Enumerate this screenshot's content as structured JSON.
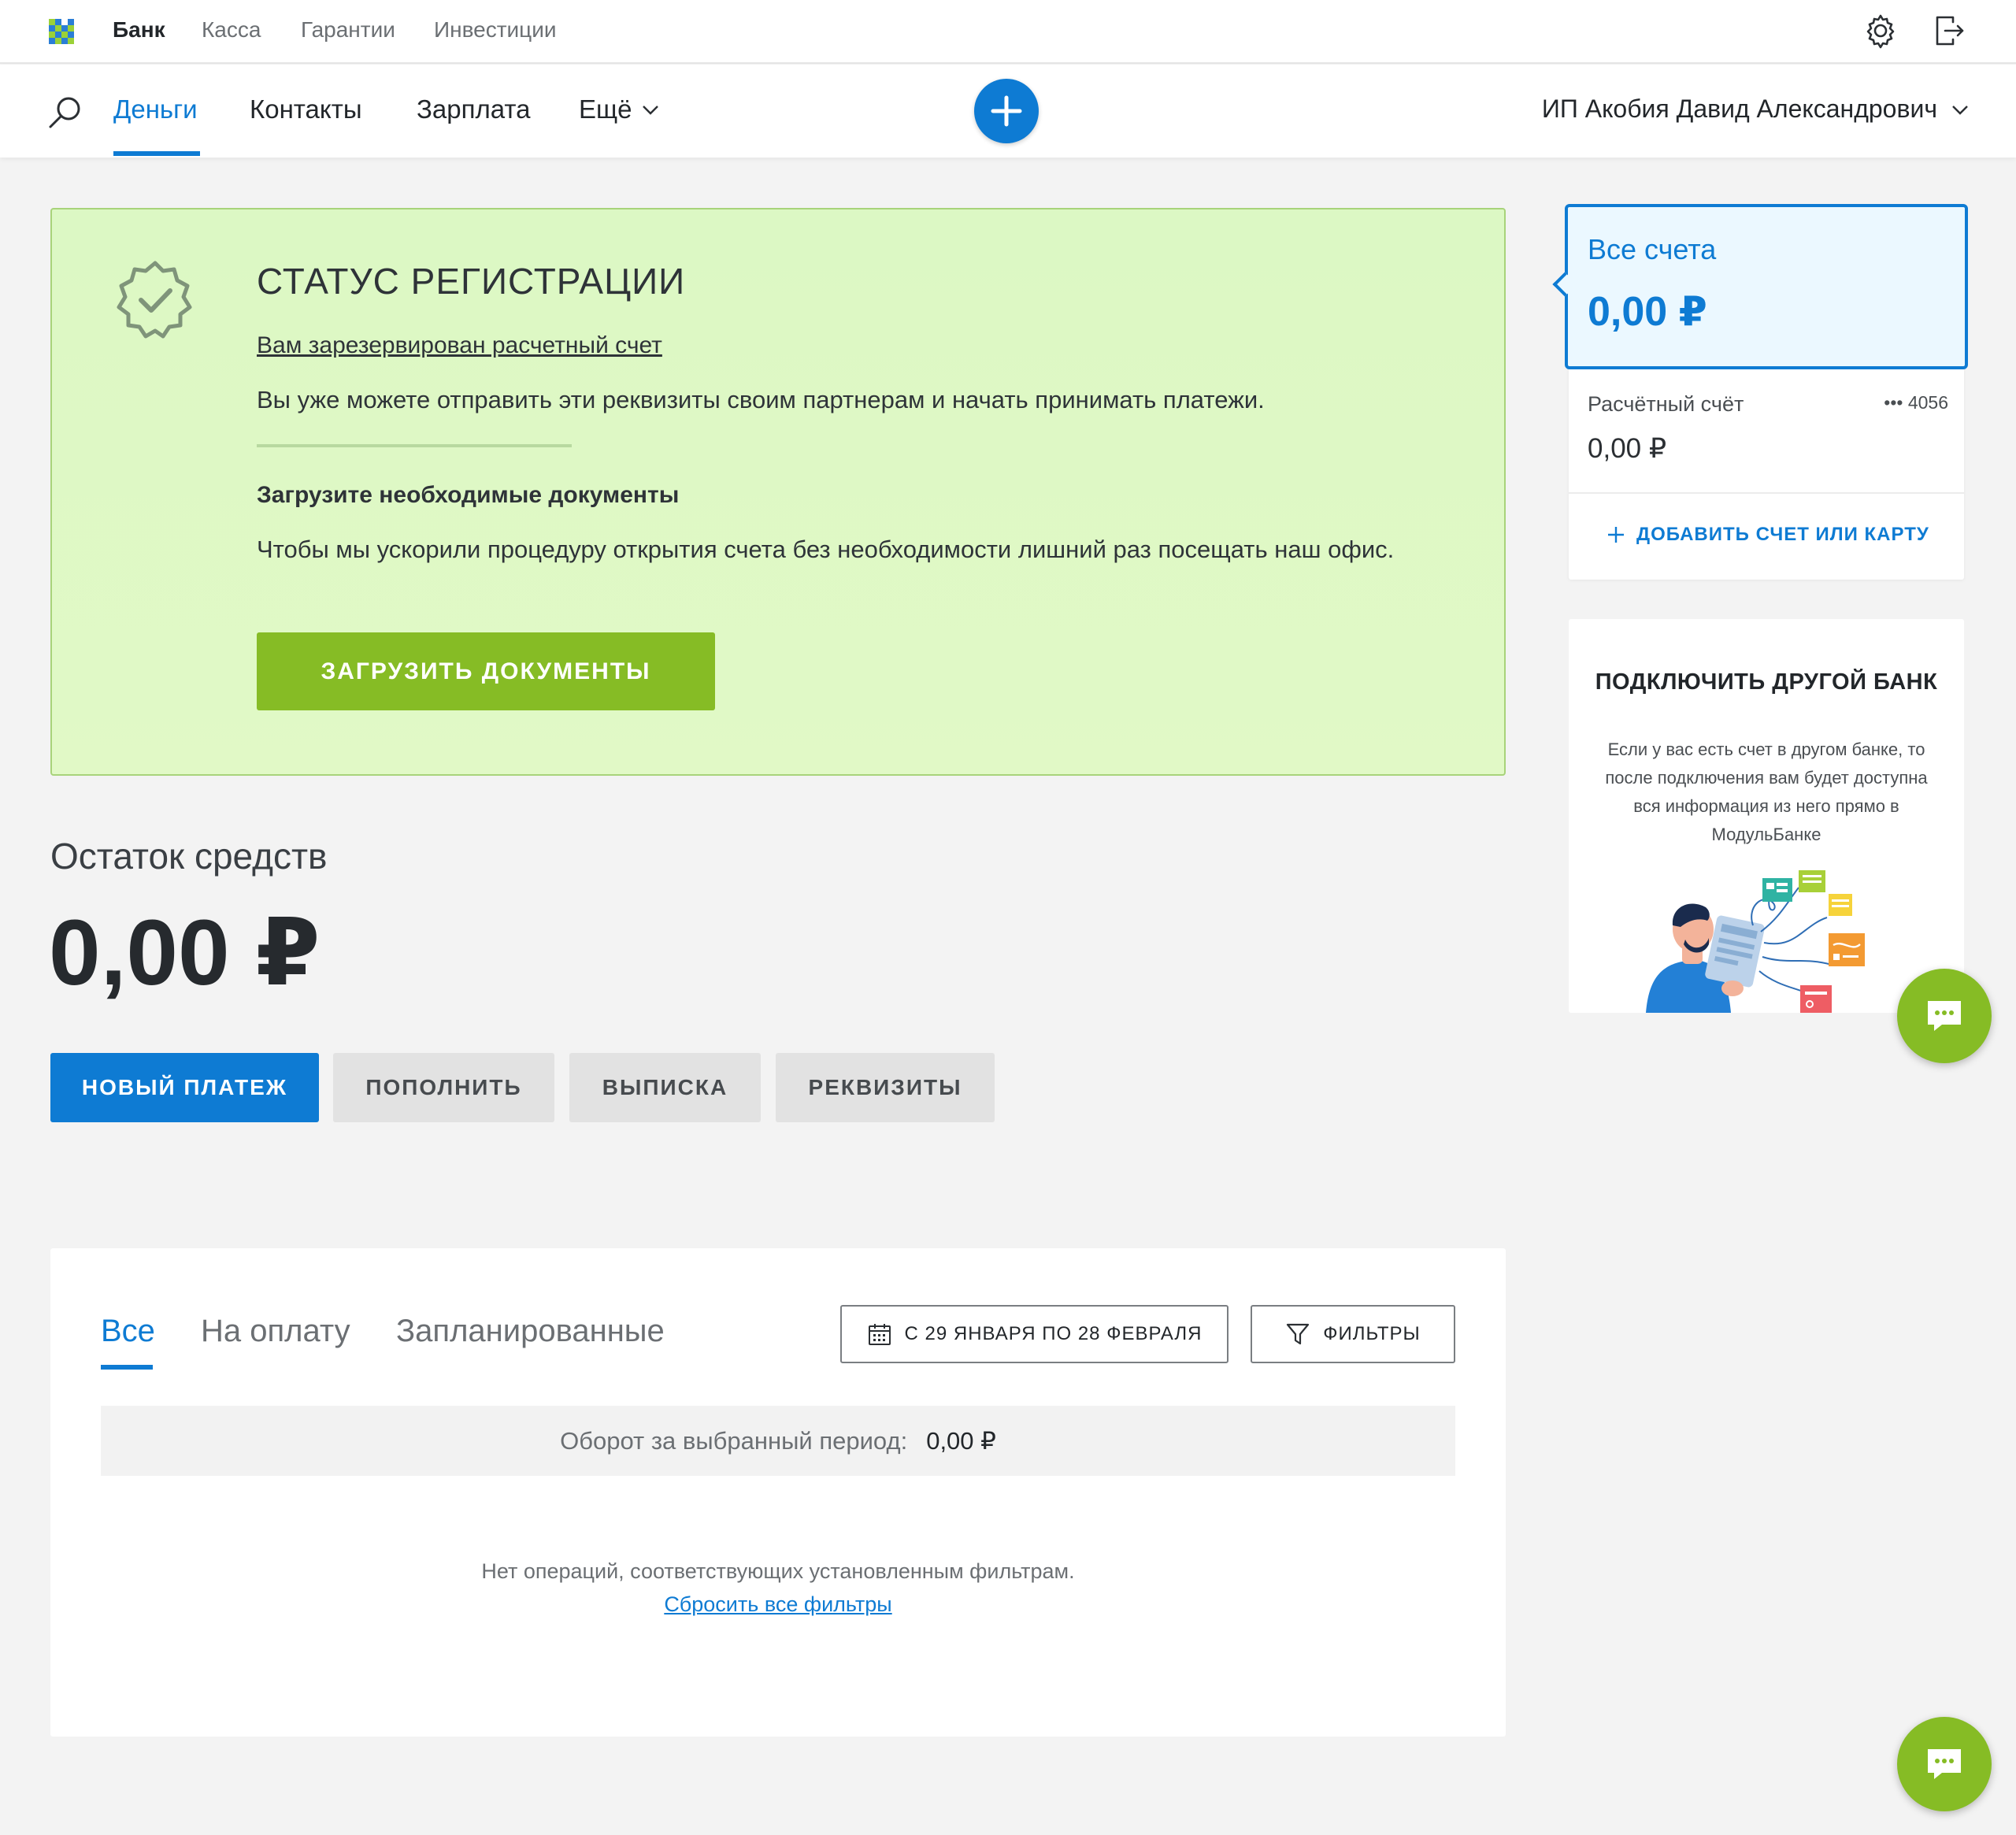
{
  "topnav": {
    "items": [
      {
        "label": "Банк",
        "active": true
      },
      {
        "label": "Касса",
        "active": false
      },
      {
        "label": "Гарантии",
        "active": false
      },
      {
        "label": "Инвестиции",
        "active": false
      }
    ],
    "icons": [
      "settings-icon",
      "logout-icon"
    ]
  },
  "mainnav": {
    "items": [
      {
        "label": "Деньги",
        "active": true
      },
      {
        "label": "Контакты",
        "active": false
      },
      {
        "label": "Зарплата",
        "active": false
      },
      {
        "label": "Ещё",
        "active": false
      }
    ],
    "user": "ИП Акобия Давид Александрович"
  },
  "banner": {
    "title": "СТАТУС РЕГИСТРАЦИИ",
    "link": "Вам зарезервирован расчетный счет",
    "text": "Вы уже можете отправить эти реквизиты своим партнерам и начать принимать платежи.",
    "subtitle": "Загрузите необходимые документы",
    "text2": "Чтобы мы ускорили процедуру открытия счета без необходимости лишний раз посещать наш офис.",
    "button": "ЗАГРУЗИТЬ ДОКУМЕНТЫ"
  },
  "balance": {
    "label": "Остаток средств",
    "value": "0,00 ₽"
  },
  "actions": {
    "new_payment": "НОВЫЙ ПЛАТЕЖ",
    "top_up": "ПОПОЛНИТЬ",
    "statement": "ВЫПИСКА",
    "requisites": "РЕКВИЗИТЫ"
  },
  "operations": {
    "tabs": [
      {
        "label": "Все",
        "active": true
      },
      {
        "label": "На оплату",
        "active": false
      },
      {
        "label": "Запланированные",
        "active": false
      }
    ],
    "date_range": "С 29 ЯНВАРЯ ПО 28 ФЕВРАЛЯ",
    "filters": "ФИЛЬТРЫ",
    "turnover_label": "Оборот за выбранный период:",
    "turnover_value": "0,00 ₽",
    "empty": "Нет операций, соответствующих установленным фильтрам.",
    "reset": "Сбросить все фильтры"
  },
  "accounts": {
    "all_title": "Все счета",
    "all_value": "0,00 ₽",
    "account_name": "Расчётный счёт",
    "account_number": "••• 4056",
    "account_value": "0,00 ₽",
    "add": "ДОБАВИТЬ СЧЕТ ИЛИ КАРТУ"
  },
  "other_bank": {
    "title": "ПОДКЛЮЧИТЬ ДРУГОЙ БАНК",
    "text": "Если у вас есть счет в другом банке, то после подключения вам будет доступна вся информация из него прямо в МодульБанке"
  },
  "colors": {
    "accent": "#0e7bd3",
    "green": "#86bc25",
    "banner_bg": "#dcf8c4",
    "page_bg": "#f3f3f3"
  }
}
